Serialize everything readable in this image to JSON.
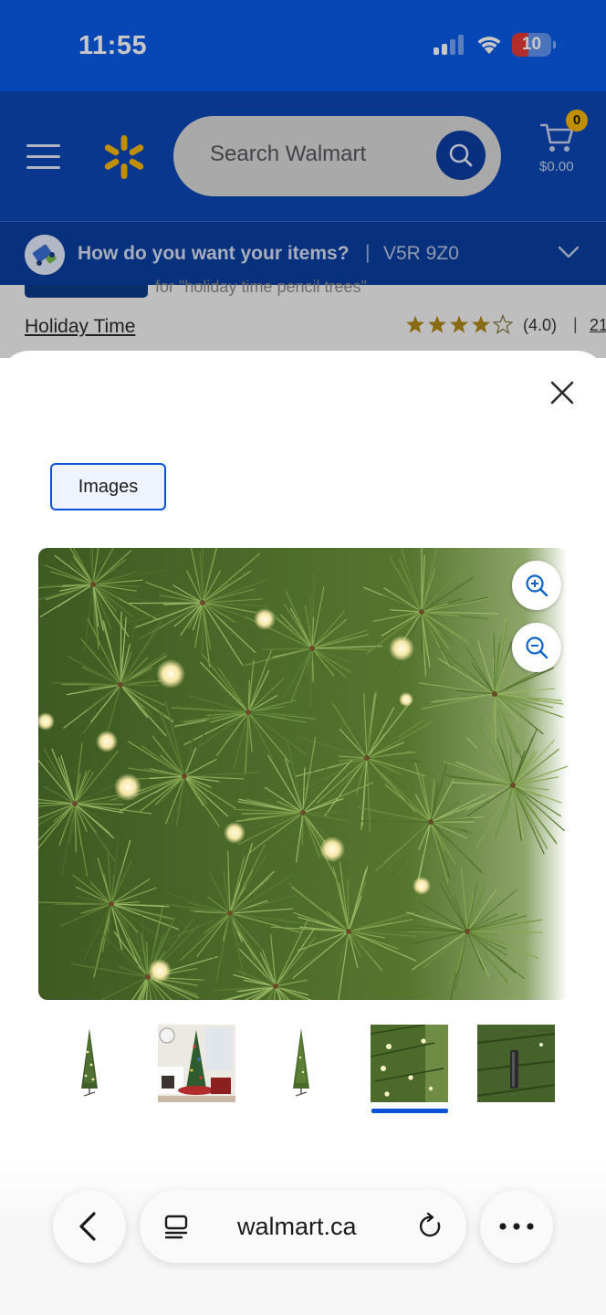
{
  "status_bar": {
    "time": "11:55",
    "battery_level": 10,
    "battery_label": "10",
    "background": "#0a5be8"
  },
  "header": {
    "search_placeholder": "Search Walmart",
    "cart_count": "0",
    "cart_total": "$0.00",
    "brand_color": "#0b47b5",
    "spark_color": "#f5b800"
  },
  "delivery": {
    "prompt": "How do you want your items?",
    "separator": "|",
    "postal_code": "V5R 9Z0"
  },
  "product_behind": {
    "subtitle_fragment": "for \"holiday time pencil trees\"",
    "brand": "Holiday Time",
    "rating_value": "(4.0)",
    "rating_stars": 4,
    "rating_separator": "|",
    "review_count": "21"
  },
  "media_sheet": {
    "tabs": [
      {
        "label": "Images",
        "selected": true
      }
    ],
    "zoom_in_icon": "zoom-in-icon",
    "zoom_out_icon": "zoom-out-icon",
    "close_icon": "close-icon",
    "thumbnails": [
      {
        "name": "pencil-tree-full",
        "selected": false
      },
      {
        "name": "tree-in-living-room",
        "selected": false
      },
      {
        "name": "pencil-tree-unlit",
        "selected": false
      },
      {
        "name": "branch-closeup-lights",
        "selected": true
      },
      {
        "name": "trunk-pole-closeup",
        "selected": false
      }
    ],
    "selected_index": 3,
    "accent": "#0b52d6"
  },
  "browser": {
    "url": "walmart.ca"
  }
}
